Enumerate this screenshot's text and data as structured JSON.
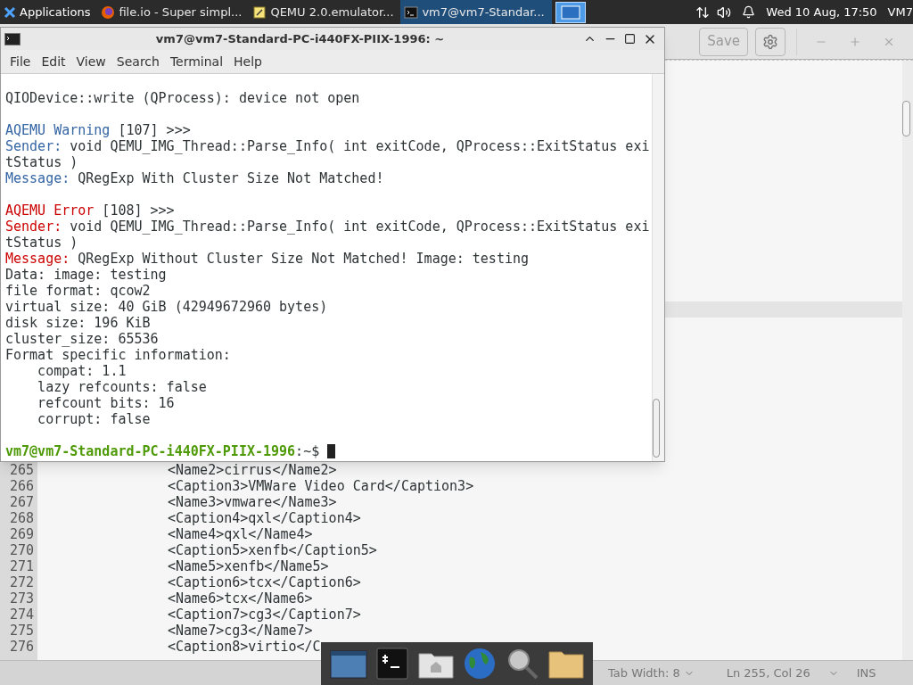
{
  "panel": {
    "apps_label": "Applications",
    "tasks": [
      {
        "kind": "browser",
        "label": "file.io - Super simpl...",
        "selected": false
      },
      {
        "kind": "notes",
        "label": "QEMU 2.0.emulator...",
        "selected": false
      },
      {
        "kind": "terminal",
        "label": "vm7@vm7-Standar...",
        "selected": true
      }
    ],
    "clock": "Wed 10 Aug, 17:50",
    "user": "VM7"
  },
  "editor": {
    "save_label": "Save",
    "lines": [
      {
        "number": "265",
        "code": "<Name2>cirrus</Name2>"
      },
      {
        "number": "266",
        "code": "<Caption3>VMWare Video Card</Caption3>"
      },
      {
        "number": "267",
        "code": "<Name3>vmware</Name3>"
      },
      {
        "number": "268",
        "code": "<Caption4>qxl</Caption4>"
      },
      {
        "number": "269",
        "code": "<Name4>qxl</Name4>"
      },
      {
        "number": "270",
        "code": "<Caption5>xenfb</Caption5>"
      },
      {
        "number": "271",
        "code": "<Name5>xenfb</Name5>"
      },
      {
        "number": "272",
        "code": "<Caption6>tcx</Caption6>"
      },
      {
        "number": "273",
        "code": "<Name6>tcx</Name6>"
      },
      {
        "number": "274",
        "code": "<Caption7>cg3</Caption7>"
      },
      {
        "number": "275",
        "code": "<Name7>cg3</Name7>"
      },
      {
        "number": "276",
        "code": "<Caption8>virtio</C"
      }
    ],
    "status": {
      "tab_width": "Tab Width: 8",
      "position": "Ln 255, Col 26",
      "mode": "INS"
    }
  },
  "terminal": {
    "title": "vm7@vm7-Standard-PC-i440FX-PIIX-1996: ~",
    "menu": [
      "File",
      "Edit",
      "View",
      "Search",
      "Terminal",
      "Help"
    ],
    "blocks": [
      [
        [
          {
            "kind": "text",
            "text": "QIODevice::write (QProcess): device not open"
          }
        ]
      ],
      [
        [
          {
            "kind": "warn",
            "text": "AQEMU Warning"
          },
          {
            "kind": "text",
            "text": " [107] >>>"
          }
        ],
        [
          {
            "kind": "warn",
            "text": "Sender:"
          },
          {
            "kind": "text",
            "text": " void QEMU_IMG_Thread::Parse_Info( int exitCode, QProcess::ExitStatus exi"
          }
        ],
        [
          {
            "kind": "text",
            "text": "tStatus )"
          }
        ],
        [
          {
            "kind": "warn",
            "text": "Message:"
          },
          {
            "kind": "text",
            "text": " QRegExp With Cluster Size Not Matched!"
          }
        ]
      ],
      [
        [
          {
            "kind": "error",
            "text": "AQEMU Error"
          },
          {
            "kind": "text",
            "text": " [108] >>>"
          }
        ],
        [
          {
            "kind": "error",
            "text": "Sender:"
          },
          {
            "kind": "text",
            "text": " void QEMU_IMG_Thread::Parse_Info( int exitCode, QProcess::ExitStatus exi"
          }
        ],
        [
          {
            "kind": "text",
            "text": "tStatus )"
          }
        ],
        [
          {
            "kind": "error",
            "text": "Message:"
          },
          {
            "kind": "text",
            "text": " QRegExp Without Cluster Size Not Matched! Image: testing"
          }
        ],
        [
          {
            "kind": "text",
            "text": "Data: image: testing"
          }
        ],
        [
          {
            "kind": "text",
            "text": "file format: qcow2"
          }
        ],
        [
          {
            "kind": "text",
            "text": "virtual size: 40 GiB (42949672960 bytes)"
          }
        ],
        [
          {
            "kind": "text",
            "text": "disk size: 196 KiB"
          }
        ],
        [
          {
            "kind": "text",
            "text": "cluster_size: 65536"
          }
        ],
        [
          {
            "kind": "text",
            "text": "Format specific information:"
          }
        ],
        [
          {
            "kind": "text",
            "text": "    compat: 1.1"
          }
        ],
        [
          {
            "kind": "text",
            "text": "    lazy refcounts: false"
          }
        ],
        [
          {
            "kind": "text",
            "text": "    refcount bits: 16"
          }
        ],
        [
          {
            "kind": "text",
            "text": "    corrupt: false"
          }
        ]
      ]
    ],
    "prompt": {
      "user_host": "vm7@vm7-Standard-PC-i440FX-PIIX-1996",
      "suffix": ":~$"
    }
  }
}
